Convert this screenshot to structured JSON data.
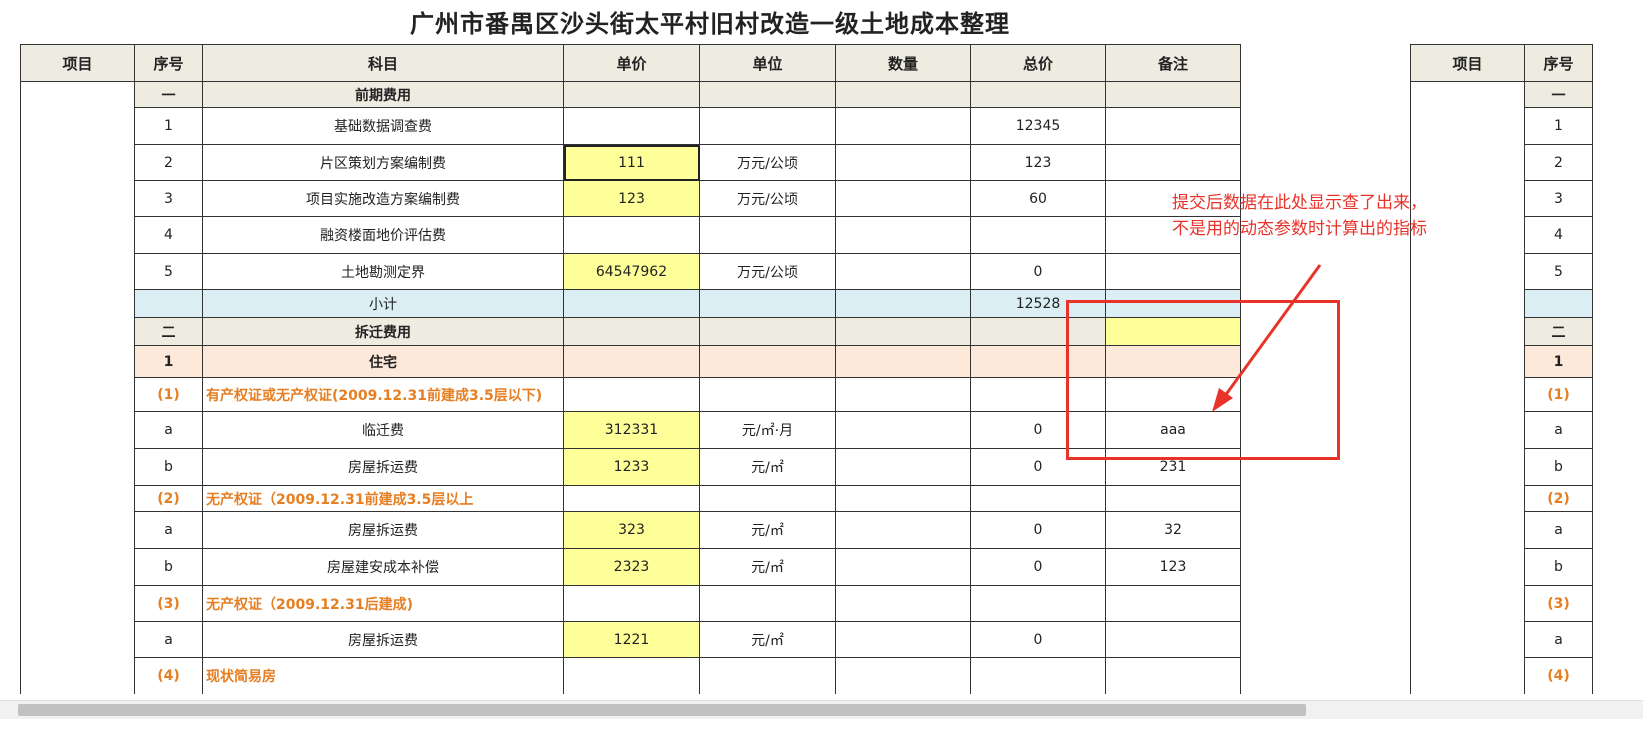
{
  "page": {
    "title": "广州市番禺区沙头街太平村旧村改造一级土地成本整理"
  },
  "table": {
    "headers": [
      "项目",
      "序号",
      "科目",
      "单价",
      "单位",
      "数量",
      "总价",
      "备注"
    ],
    "rows": [
      {
        "style": "cat",
        "seq": "一",
        "subject": "前期费用",
        "price": "",
        "unit": "",
        "qty": "",
        "total": "",
        "note": ""
      },
      {
        "style": "item",
        "seq": "1",
        "subject": "基础数据调查费",
        "price": "",
        "unit": "",
        "qty": "",
        "total": "12345",
        "note": ""
      },
      {
        "style": "item-y",
        "seq": "2",
        "subject": "片区策划方案编制费",
        "price": "111",
        "unit": "万元/公顷",
        "qty": "",
        "total": "123",
        "note": "",
        "selected": true
      },
      {
        "style": "item-y",
        "seq": "3",
        "subject": "项目实施改造方案编制费",
        "price": "123",
        "unit": "万元/公顷",
        "qty": "",
        "total": "60",
        "note": ""
      },
      {
        "style": "item",
        "seq": "4",
        "subject": "融资楼面地价评估费",
        "price": "",
        "unit": "",
        "qty": "",
        "total": "",
        "note": ""
      },
      {
        "style": "item-y",
        "seq": "5",
        "subject": "土地勘测定界",
        "price": "64547962",
        "unit": "万元/公顷",
        "qty": "",
        "total": "0",
        "note": ""
      },
      {
        "style": "subtotal",
        "seq": "",
        "subject": "小计",
        "price": "",
        "unit": "",
        "qty": "",
        "total": "12528",
        "note": ""
      },
      {
        "style": "cat",
        "seq": "二",
        "subject": "拆迁费用",
        "price": "",
        "unit": "",
        "qty": "",
        "total": "",
        "note": ""
      },
      {
        "style": "peach",
        "seq": "1",
        "subject": "住宅",
        "price": "",
        "unit": "",
        "qty": "",
        "total": "",
        "note": ""
      },
      {
        "style": "orange",
        "seq": "(1)",
        "subject": "有产权证或无产权证(2009.12.31前建成3.5层以下)",
        "price": "",
        "unit": "",
        "qty": "",
        "total": "",
        "note": ""
      },
      {
        "style": "item-y",
        "seq": "a",
        "subject": "临迁费",
        "price": "312331",
        "unit": "元/㎡·月",
        "qty": "",
        "total": "0",
        "note": "aaa"
      },
      {
        "style": "item-y",
        "seq": "b",
        "subject": "房屋拆运费",
        "price": "1233",
        "unit": "元/㎡",
        "qty": "",
        "total": "0",
        "note": "231"
      },
      {
        "style": "orange",
        "seq": "(2)",
        "subject": "无产权证（2009.12.31前建成3.5层以上",
        "price": "",
        "unit": "",
        "qty": "",
        "total": "",
        "note": ""
      },
      {
        "style": "item-y",
        "seq": "a",
        "subject": "房屋拆运费",
        "price": "323",
        "unit": "元/㎡",
        "qty": "",
        "total": "0",
        "note": "32"
      },
      {
        "style": "item-y",
        "seq": "b",
        "subject": "房屋建安成本补偿",
        "price": "2323",
        "unit": "元/㎡",
        "qty": "",
        "total": "0",
        "note": "123"
      },
      {
        "style": "orange",
        "seq": "(3)",
        "subject": "无产权证（2009.12.31后建成)",
        "price": "",
        "unit": "",
        "qty": "",
        "total": "",
        "note": ""
      },
      {
        "style": "item-y",
        "seq": "a",
        "subject": "房屋拆运费",
        "price": "1221",
        "unit": "元/㎡",
        "qty": "",
        "total": "0",
        "note": ""
      },
      {
        "style": "orange",
        "seq": "(4)",
        "subject": "现状简易房",
        "price": "",
        "unit": "",
        "qty": "",
        "total": "",
        "note": ""
      }
    ]
  },
  "annotation": {
    "lines": [
      "提交后数据在此处显示查了出来，",
      "不是用的动态参数时计算出的指标"
    ],
    "color": "#e8332a"
  },
  "colors": {
    "header_bg": "#eeece1",
    "subtotal_bg": "#daeef3",
    "section_bg": "#fde9d9",
    "input_bg": "#ffff99",
    "orange_text": "#e67e22"
  }
}
